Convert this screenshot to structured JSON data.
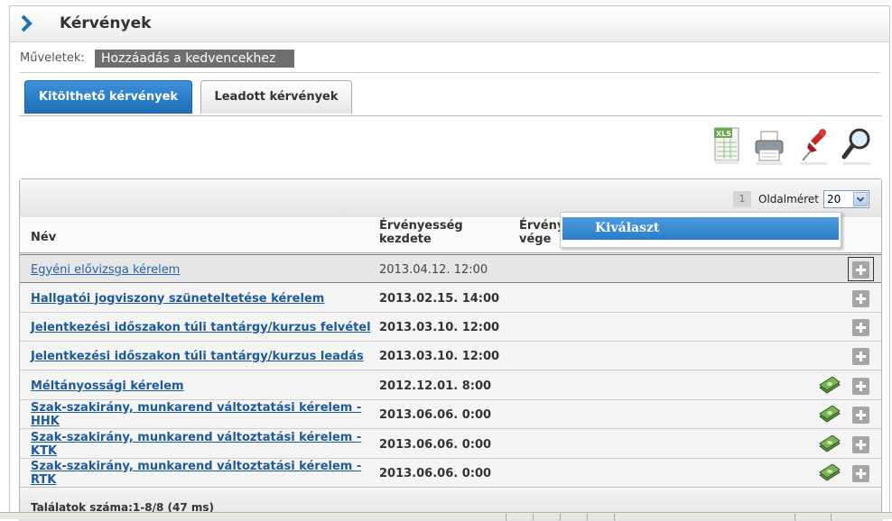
{
  "header": {
    "title": "Kérvények"
  },
  "operations": {
    "label": "Műveletek:",
    "add_favorite": "Hozzáadás a kedvencekhez"
  },
  "tabs": [
    {
      "label": "Kitölthető kérvények",
      "active": true
    },
    {
      "label": "Leadott kérvények",
      "active": false
    }
  ],
  "toolbar_icons": [
    "xls-export-icon",
    "print-icon",
    "pin-icon",
    "search-icon"
  ],
  "pager": {
    "current_page": "1",
    "page_size_label": "Oldalméret",
    "page_size_value": "20"
  },
  "columns": {
    "name": "Név",
    "start": "Érvényesség kezdete",
    "end": "Érvény vége"
  },
  "popup": {
    "item": "Kiválaszt"
  },
  "rows": [
    {
      "name": "Egyéni elővizsga kérelem",
      "start": "2013.04.12. 12:00",
      "payment": false,
      "selected": true
    },
    {
      "name": "Hallgatói jogviszony szüneteltetése kérelem",
      "start": "2013.02.15. 14:00",
      "payment": false,
      "selected": false
    },
    {
      "name": "Jelentkezési időszakon túli tantárgy/kurzus felvétel",
      "start": "2013.03.10. 12:00",
      "payment": false,
      "selected": false
    },
    {
      "name": "Jelentkezési időszakon túli tantárgy/kurzus leadás",
      "start": "2013.03.10. 12:00",
      "payment": false,
      "selected": false
    },
    {
      "name": "Méltányossági kérelem",
      "start": "2012.12.01. 8:00",
      "payment": true,
      "selected": false
    },
    {
      "name": "Szak-szakirány, munkarend változtatási kérelem - HHK",
      "start": "2013.06.06. 0:00",
      "payment": true,
      "selected": false
    },
    {
      "name": "Szak-szakirány, munkarend változtatási kérelem - KTK",
      "start": "2013.06.06. 0:00",
      "payment": true,
      "selected": false
    },
    {
      "name": "Szak-szakirány, munkarend változtatási kérelem - RTK",
      "start": "2013.06.06. 0:00",
      "payment": true,
      "selected": false
    }
  ],
  "footer": {
    "results": "Találatok száma:1-8/8 (47 ms)"
  },
  "colors": {
    "accent": "#1e6fb8",
    "link": "#1b5a9c",
    "plus_button": "#a5a5a5"
  }
}
